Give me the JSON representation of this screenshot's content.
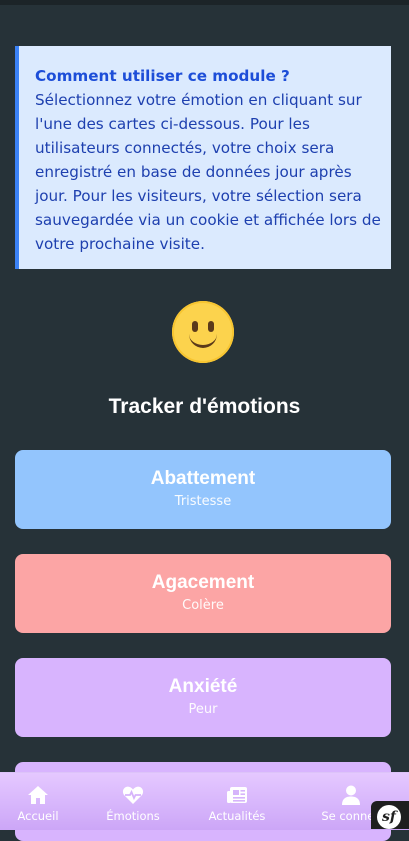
{
  "info": {
    "title": "Comment utiliser ce module ?",
    "text": "Sélectionnez votre émotion en cliquant sur l'une des cartes ci-dessous. Pour les utilisateurs connectés, votre choix sera enregistré en base de données jour après jour. Pour les visiteurs, votre sélection sera sauvegardée via un cookie et affichée lors de votre prochaine visite."
  },
  "emoji": {
    "icon": "slightly-smiling-face-icon"
  },
  "heading": "Tracker d'émotions",
  "cards": [
    {
      "name": "Abattement",
      "category": "Tristesse",
      "color": "#93c5fd"
    },
    {
      "name": "Agacement",
      "category": "Colère",
      "color": "#fca5a5"
    },
    {
      "name": "Anxiété",
      "category": "Peur",
      "color": "#d8b4fe"
    }
  ],
  "nav": {
    "items": [
      {
        "label": "Accueil",
        "icon": "home-icon"
      },
      {
        "label": "Émotions",
        "icon": "heartbeat-icon"
      },
      {
        "label": "Actualités",
        "icon": "newspaper-icon"
      },
      {
        "label": "Se connec",
        "icon": "user-icon"
      }
    ]
  },
  "debug_toolbar": {
    "label": "sf",
    "icon": "symfony-icon"
  }
}
